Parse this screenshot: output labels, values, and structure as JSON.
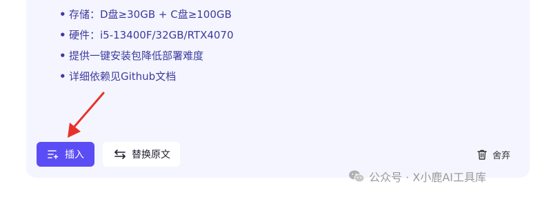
{
  "content": {
    "bullets": [
      "存储：D盘≥30GB + C盘≥100GB",
      "硬件：i5-13400F/32GB/RTX4070",
      "提供一键安装包降低部署难度",
      "详细依赖见Github文档"
    ],
    "bullet_symbol": "•"
  },
  "actions": {
    "insert_label": "插入",
    "replace_label": "替换原文",
    "discard_label": "舍弃"
  },
  "watermark": {
    "text": "公众号 · X小鹿AI工具库"
  },
  "colors": {
    "panel_bg": "#f4f5fe",
    "text": "#3d3a9e",
    "accent": "#5a4df5",
    "arrow": "#e8302a"
  },
  "icons": {
    "insert": "list-add-icon",
    "replace": "swap-arrows-icon",
    "discard": "trash-icon",
    "watermark": "wechat-icon"
  }
}
